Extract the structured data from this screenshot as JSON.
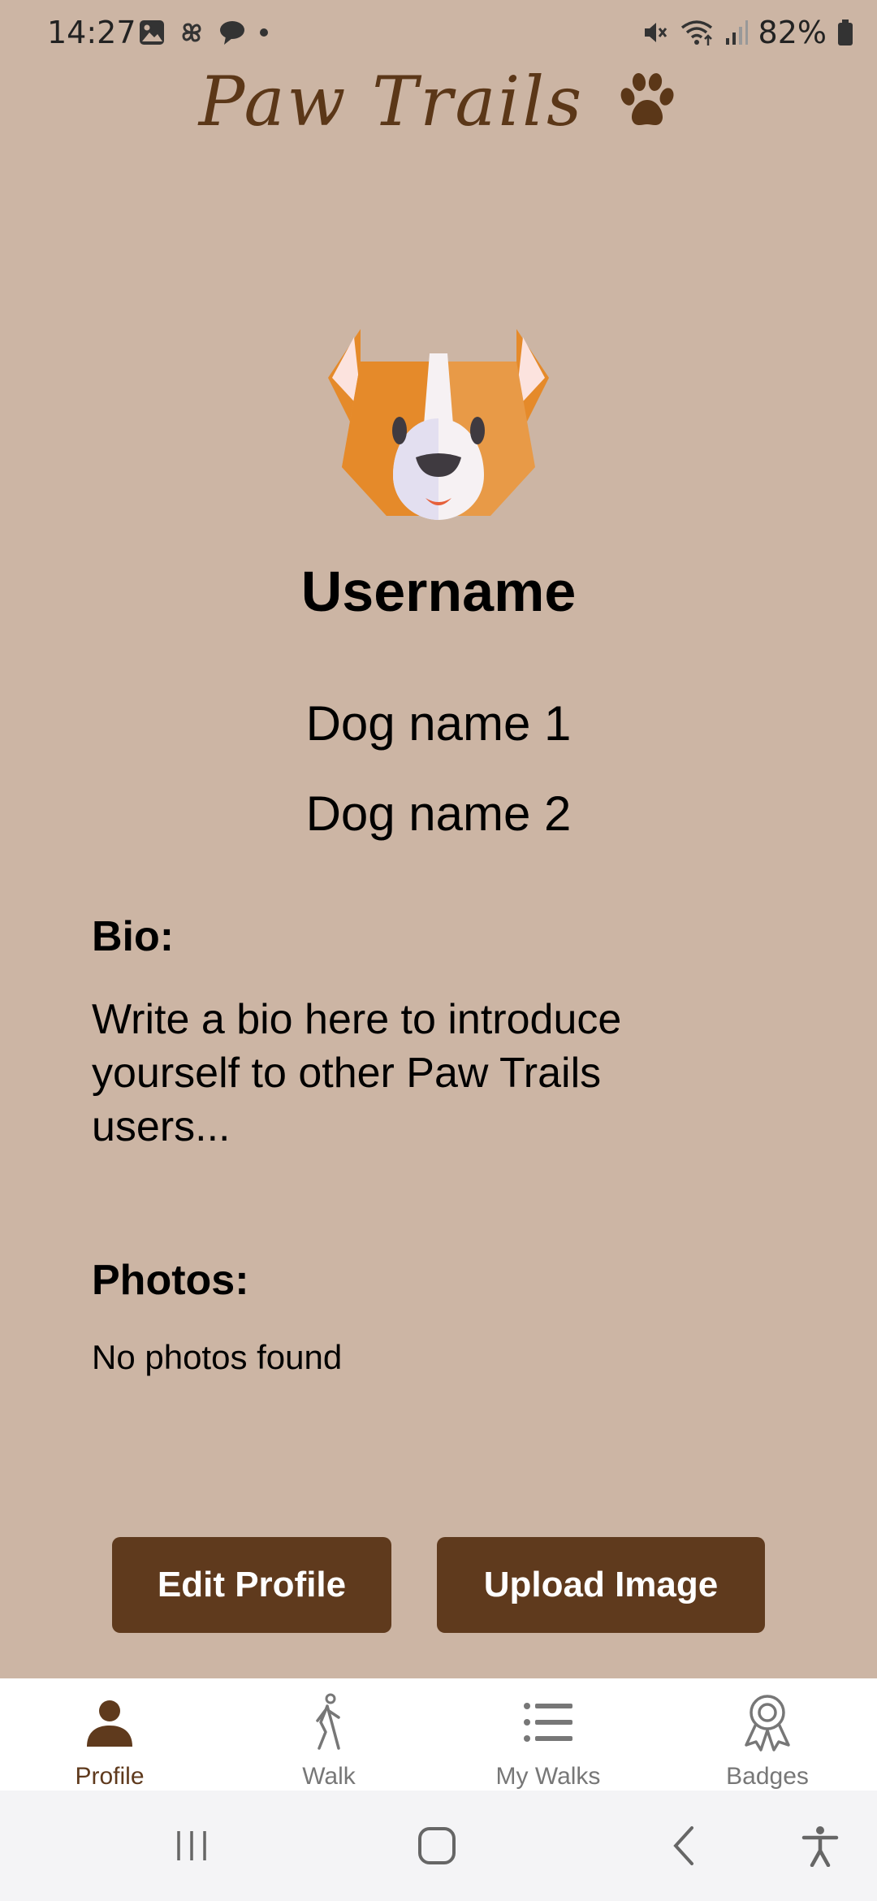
{
  "status_bar": {
    "time": "14:27",
    "battery": "82%",
    "left_icons": [
      "image-icon",
      "pinwheel-icon",
      "chat-icon",
      "dot-icon"
    ],
    "right_icons": [
      "mute-icon",
      "wifi-icon",
      "signal-icon",
      "battery-icon"
    ]
  },
  "header": {
    "title": "Paw Trails",
    "logo_icon": "paw-icon"
  },
  "profile": {
    "username": "Username",
    "dogs": [
      "Dog name 1",
      "Dog name 2"
    ],
    "bio_label": "Bio:",
    "bio_text": "Write a bio here to introduce yourself to other Paw Trails users...",
    "photos_label": "Photos:",
    "photos_empty": "No photos found"
  },
  "actions": {
    "edit_profile": "Edit Profile",
    "upload_image": "Upload Image"
  },
  "bottom_nav": {
    "items": [
      {
        "label": "Profile",
        "icon": "person-icon",
        "active": true
      },
      {
        "label": "Walk",
        "icon": "walk-icon",
        "active": false
      },
      {
        "label": "My Walks",
        "icon": "list-icon",
        "active": false
      },
      {
        "label": "Badges",
        "icon": "badge-icon",
        "active": false
      }
    ]
  },
  "colors": {
    "background": "#CCB5A4",
    "brand_brown": "#5F3A1D",
    "title_brown": "#5B3718",
    "nav_bg": "#FFFFFF"
  }
}
